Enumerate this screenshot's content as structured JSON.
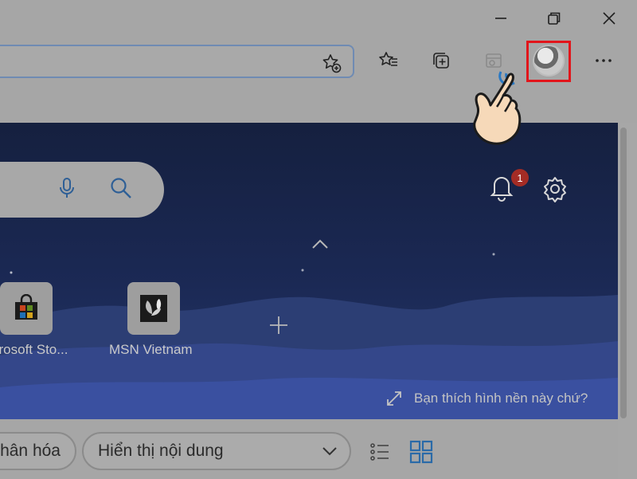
{
  "window": {
    "controls": {
      "minimize": "minimize-icon",
      "restore": "restore-icon",
      "close": "close-icon"
    }
  },
  "toolbar": {
    "icons": [
      "favorite-add-icon",
      "favorites-icon",
      "collections-icon",
      "ie-mode-icon",
      "profile-avatar",
      "more-icon"
    ],
    "highlight_color": "#e2151b"
  },
  "newtab": {
    "notification_count": "1",
    "tiles": [
      {
        "label": "crosoft Sto...",
        "icon": "microsoft-store-icon"
      },
      {
        "label": "MSN Vietnam",
        "icon": "msn-icon"
      }
    ],
    "wallpaper_prompt": "Bạn thích hình nền này chứ?"
  },
  "bottom": {
    "personalize_label": "hân hóa",
    "content_select": "Hiển thị nội dung"
  },
  "colors": {
    "hero_top": "#15203f",
    "hero_bottom": "#26396c",
    "badge": "#a42c25"
  }
}
